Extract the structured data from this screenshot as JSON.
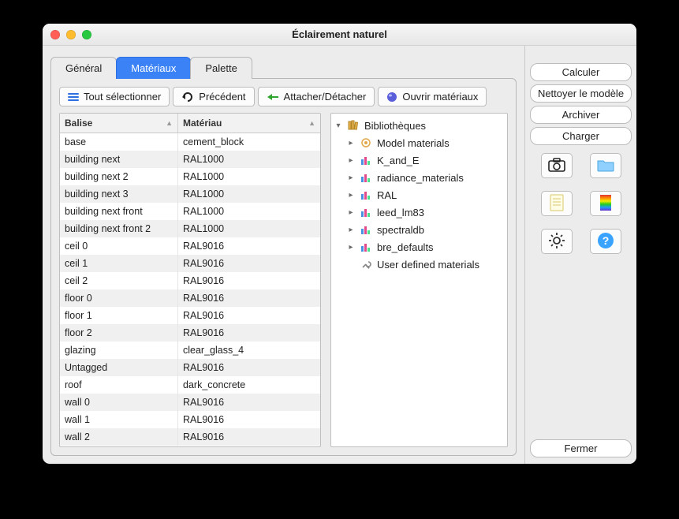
{
  "window": {
    "title": "Éclairement naturel"
  },
  "tabs": {
    "general": "Général",
    "materials": "Matériaux",
    "palette": "Palette"
  },
  "toolbar": {
    "select_all": "Tout sélectionner",
    "previous": "Précédent",
    "attach": "Attacher/Détacher",
    "open_materials": "Ouvrir matériaux"
  },
  "table": {
    "headers": {
      "tag": "Balise",
      "material": "Matériau"
    },
    "rows": [
      {
        "tag": "base",
        "material": "cement_block"
      },
      {
        "tag": "building next",
        "material": "RAL1000"
      },
      {
        "tag": "building next 2",
        "material": "RAL1000"
      },
      {
        "tag": "building next 3",
        "material": "RAL1000"
      },
      {
        "tag": "building next front",
        "material": "RAL1000"
      },
      {
        "tag": "building next front 2",
        "material": "RAL1000"
      },
      {
        "tag": "ceil 0",
        "material": "RAL9016"
      },
      {
        "tag": "ceil 1",
        "material": "RAL9016"
      },
      {
        "tag": "ceil 2",
        "material": "RAL9016"
      },
      {
        "tag": "floor 0",
        "material": "RAL9016"
      },
      {
        "tag": "floor 1",
        "material": "RAL9016"
      },
      {
        "tag": "floor 2",
        "material": "RAL9016"
      },
      {
        "tag": "glazing",
        "material": "clear_glass_4"
      },
      {
        "tag": "Untagged",
        "material": "RAL9016"
      },
      {
        "tag": "roof",
        "material": "dark_concrete"
      },
      {
        "tag": "wall 0",
        "material": "RAL9016"
      },
      {
        "tag": "wall 1",
        "material": "RAL9016"
      },
      {
        "tag": "wall 2",
        "material": "RAL9016"
      }
    ]
  },
  "tree": {
    "root": "Bibliothèques",
    "children": [
      "Model materials",
      "K_and_E",
      "radiance_materials",
      "RAL",
      "leed_lm83",
      "spectraldb",
      "bre_defaults"
    ],
    "user_defined": "User defined materials"
  },
  "sidebar": {
    "calculate": "Calculer",
    "clean_model": "Nettoyer le modèle",
    "archive": "Archiver",
    "load": "Charger",
    "close": "Fermer"
  }
}
